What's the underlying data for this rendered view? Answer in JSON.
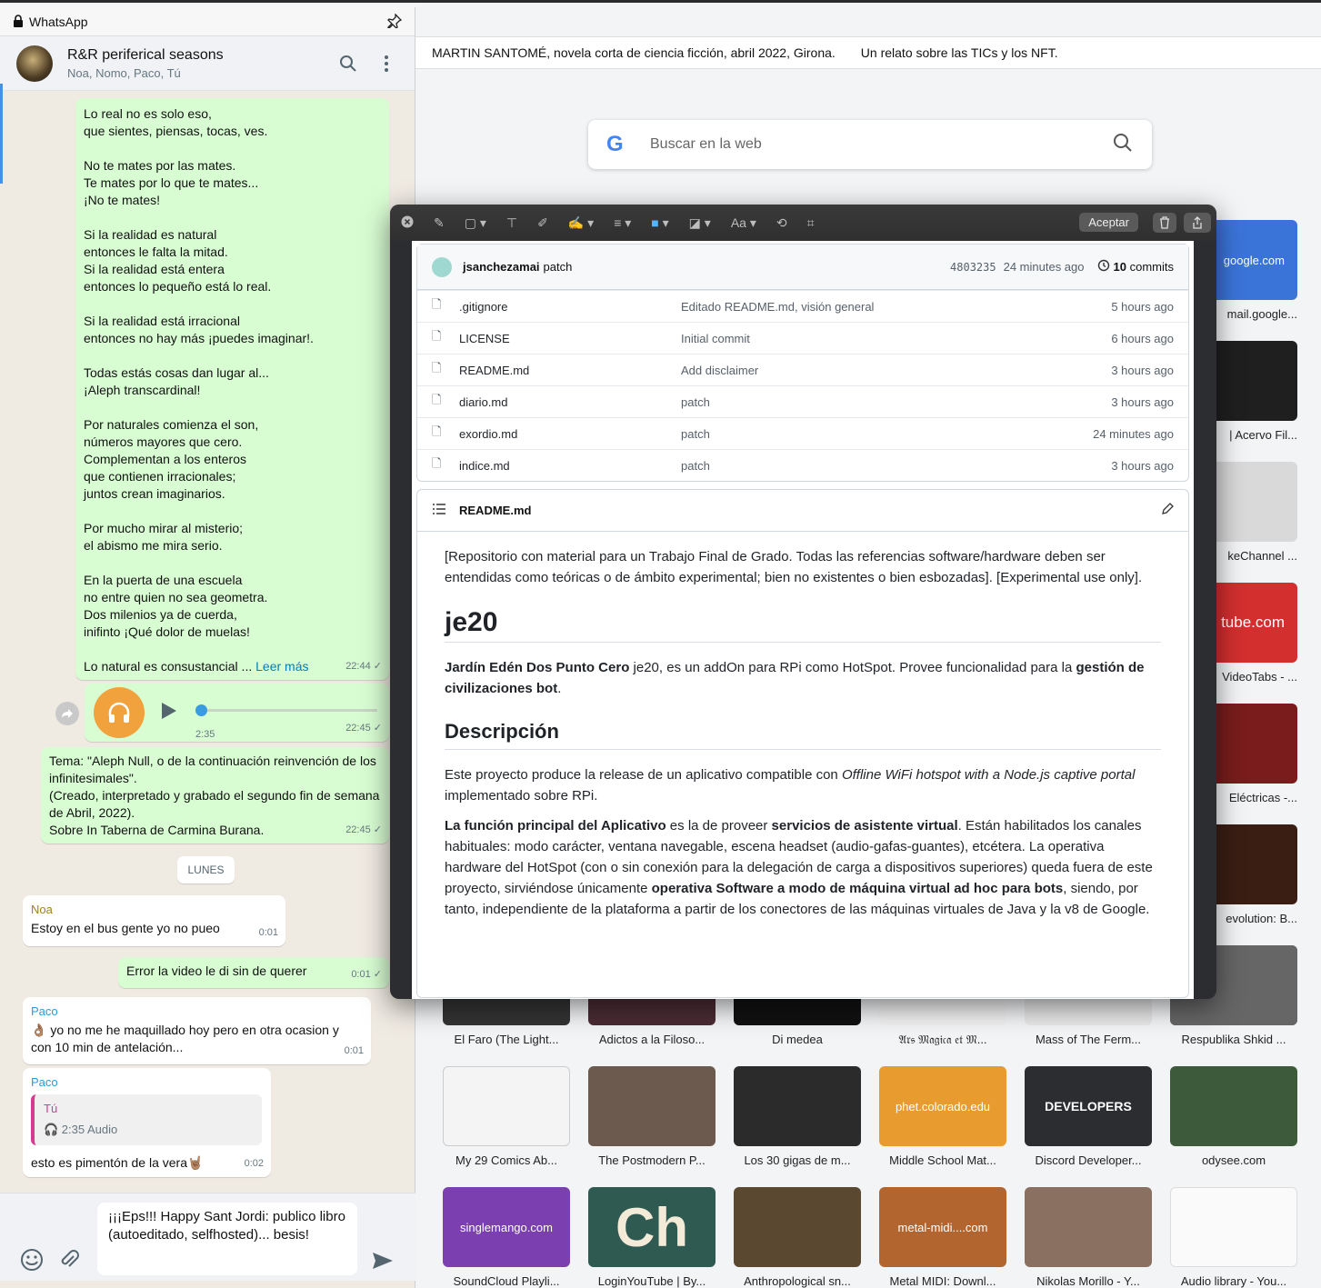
{
  "browser": {
    "bookmarks": [
      "MARTIN SANTOMÉ, novela corta de ciencia ficción, abril 2022, Girona.",
      "Un relato sobre las TICs y los NFT."
    ],
    "search_placeholder": "Buscar en la web",
    "side_tiles": [
      {
        "caption": "mail.google...",
        "label": "google.com",
        "color": "#3b74d9"
      },
      {
        "caption": "| Acervo Fil...",
        "label": "",
        "color": "#1f1f1f"
      },
      {
        "caption": "keChannel ...",
        "label": "",
        "color": "#d9d9d9"
      },
      {
        "caption": "VideoTabs - ...",
        "label": "tube.com",
        "color": "#d32f2f"
      },
      {
        "caption": "Eléctricas -...",
        "label": "",
        "color": "#7a1c1c"
      },
      {
        "caption": "evolution: B...",
        "label": "",
        "color": "#3a1e14"
      },
      {
        "caption": "",
        "label": "",
        "color": "#555555"
      }
    ],
    "row1": [
      {
        "caption": "El Faro (The Light...",
        "label": "",
        "color": "#333333"
      },
      {
        "caption": "Adictos a la Filoso...",
        "label": "",
        "color": "#4a2b34"
      },
      {
        "caption": "Di medea",
        "label": "",
        "color": "#111111"
      },
      {
        "caption": "𝔄𝔯𝔰 𝔐𝔞𝔤𝔦𝔠𝔞 𝔢𝔱 𝔐...",
        "label": "",
        "color": "#f2f2f2"
      },
      {
        "caption": "Mass of The Ferm...",
        "label": "",
        "color": "#e8e8e8"
      },
      {
        "caption": "Respublika Shkid ...",
        "label": "",
        "color": "#666666"
      }
    ],
    "row2": [
      {
        "caption": "My 29 Comics Ab...",
        "label": "",
        "color": "#f4f4f4"
      },
      {
        "caption": "The Postmodern P...",
        "label": "",
        "color": "#6b5a4d"
      },
      {
        "caption": "Los 30 gigas de m...",
        "label": "",
        "color": "#2b2b2b"
      },
      {
        "caption": "Middle School Mat...",
        "label": "phet.colorado.edu",
        "color": "#e89b2e"
      },
      {
        "caption": "Discord Developer...",
        "label": "DEVELOPERS",
        "color": "#2b2d31"
      },
      {
        "caption": "odysee.com",
        "label": "",
        "color": "#3d5a3a"
      }
    ],
    "row3": [
      {
        "caption": "SoundCloud Playli...",
        "label": "singlemango.com",
        "color": "#7b3fb0"
      },
      {
        "caption": "LoginYouTube | By...",
        "label": "",
        "color": "#2f5a52"
      },
      {
        "caption": "Anthropological sn...",
        "label": "",
        "color": "#5a4830"
      },
      {
        "caption": "Metal MIDI: Downl...",
        "label": "metal-midi....com",
        "color": "#b2652e"
      },
      {
        "caption": "Nikolas Morillo - Y...",
        "label": "",
        "color": "#8a7060"
      },
      {
        "caption": "Audio library - You...",
        "label": "",
        "color": "#fafafa"
      }
    ]
  },
  "whatsapp": {
    "app_title": "WhatsApp",
    "chat_name": "R&R periferical seasons",
    "members": "Noa, Nomo, Paco, Tú",
    "poem": "Lo real no es solo eso,\nque sientes, piensas, tocas, ves.\n\nNo te mates por las mates.\nTe mates por lo que te mates...\n¡No te mates!\n\nSi la realidad es natural\nentonces le falta la mitad.\nSi la realidad está entera\nentonces lo pequeño está lo real.\n\nSi la realidad está irracional\nentonces no hay más ¡puedes imaginar!.\n\nTodas estás cosas dan lugar al...\n¡Aleph transcardinal!\n\nPor naturales comienza el son,\nnúmeros mayores que cero.\nComplementan  a los enteros\nque contienen irracionales;\njuntos crean imaginarios.\n\nPor mucho mirar al misterio;\nel abismo me mira serio.\n\nEn la puerta de una escuela\nno entre quien no sea geometra.\nDos milenios ya de cuerda,\ninifinto ¡Qué dolor de muelas!\n\nLo natural es consustancial ...",
    "read_more": "Leer más",
    "poem_time": "22:44 ✓",
    "audio_duration": "2:35",
    "audio_time": "22:45 ✓",
    "desc": "Tema: \"Aleph Null, o de la continuación reinvención de los infinitesimales\".\n(Creado, interpretado y grabado el segundo fin de semana de Abril, 2022).\nSobre In Taberna de Carmina Burana.",
    "desc_time": "22:45 ✓",
    "day_label": "LUNES",
    "msg1_sender": "Noa",
    "msg1_text": "Estoy en el bus gente yo no pueo",
    "msg1_time": "0:01",
    "msg2_text": "Error la video le di sin de querer",
    "msg2_time": "0:01 ✓",
    "msg3_sender": "Paco",
    "msg3_text": "👌🏽 yo no me he maquillado hoy pero en otra ocasion y con 10 min de antelación...",
    "msg3_time": "0:01",
    "msg4_sender": "Paco",
    "msg4_quote_sender": "Tú",
    "msg4_quote_text": "🎧 2:35 Audio",
    "msg4_text": "esto es pimentón de la vera🤘🏽",
    "msg4_time": "0:02",
    "composer_text": "¡¡¡Eps!!! Happy Sant Jordi: publico libro (autoeditado, selfhosted)... besis!"
  },
  "markup": {
    "accept": "Aceptar",
    "tool_font": "Aa",
    "repo_user": "jsanchezamai",
    "repo_msg": "patch",
    "commit_hash": "4803235",
    "commit_age": "24 minutes ago",
    "commit_count": "10",
    "commit_word": "commits",
    "files": [
      {
        "name": ".gitignore",
        "msg": "Editado README.md, visión general",
        "date": "5 hours ago"
      },
      {
        "name": "LICENSE",
        "msg": "Initial commit",
        "date": "6 hours ago"
      },
      {
        "name": "README.md",
        "msg": "Add disclaimer",
        "date": "3 hours ago"
      },
      {
        "name": "diario.md",
        "msg": "patch",
        "date": "3 hours ago"
      },
      {
        "name": "exordio.md",
        "msg": "patch",
        "date": "24 minutes ago"
      },
      {
        "name": "indice.md",
        "msg": "patch",
        "date": "3 hours ago"
      }
    ],
    "readme_title": "README.md",
    "readme_intro": "[Repositorio con material para un Trabajo Final de Grado. Todas las referencias software/hardware deben ser entendidas como teóricas o de ámbito experimental; bien no existentes o bien esbozadas]. [Experimental use only].",
    "h1": "je20",
    "p1_bold1": "Jardín Edén Dos Punto Cero",
    "p1_mid": " je20, es un addOn para RPi como HotSpot. Provee funcionalidad para la ",
    "p1_bold2": "gestión de civilizaciones bot",
    "p1_end": ".",
    "h2": "Descripción",
    "p2_a": "Este proyecto produce la release de un aplicativo compatible con ",
    "p2_em": "Offline WiFi hotspot with a Node.js captive portal",
    "p2_b": " implementado sobre RPi.",
    "p3_b1": "La función principal del Aplicativo",
    "p3_t1": " es la de proveer ",
    "p3_b2": "servicios de asistente virtual",
    "p3_t2": ". Están habilitados los canales habituales: modo carácter, ventana navegable, escena headset (audio-gafas-guantes), etcétera. La operativa hardware del HotSpot (con o sin conexión para la delegación de carga a dispositivos superiores) queda fuera de este proyecto, sirviéndose únicamente ",
    "p3_b3": "operativa Software a modo de máquina virtual ad hoc para bots",
    "p3_t3": ", siendo, por tanto, independiente de la plataforma a partir de los conectores de las máquinas virtuales de Java y la v8 de Google."
  }
}
